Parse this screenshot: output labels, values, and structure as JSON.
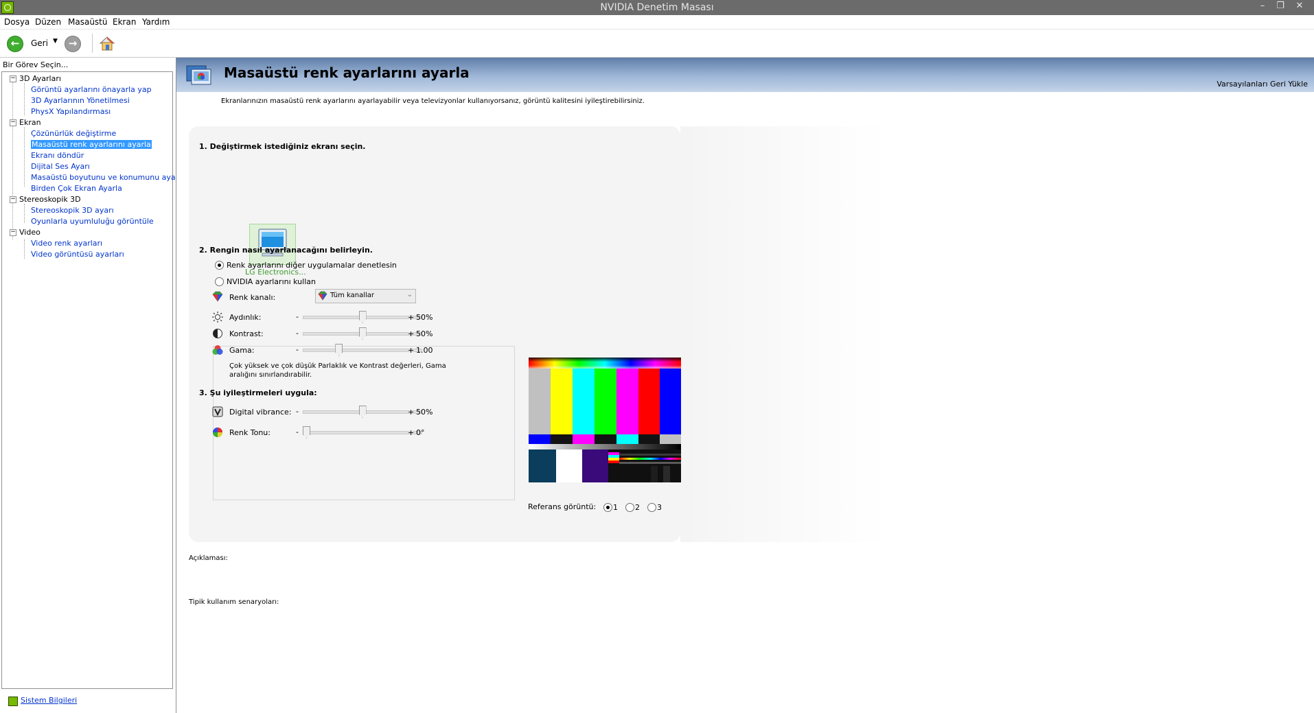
{
  "window": {
    "title": "NVIDIA Denetim Masası"
  },
  "menu": [
    "Dosya",
    "Düzen",
    "Masaüstü",
    "Ekran",
    "Yardım"
  ],
  "toolbar": {
    "back_label": "Geri"
  },
  "left": {
    "header": "Bir Görev Seçin...",
    "tree": [
      {
        "label": "3D Ayarları",
        "type": "cat"
      },
      {
        "label": "Görüntü ayarlarını önayarla yap",
        "type": "link"
      },
      {
        "label": "3D Ayarlarının Yönetilmesi",
        "type": "link"
      },
      {
        "label": "PhysX Yapılandırması",
        "type": "link"
      },
      {
        "label": "Ekran",
        "type": "cat"
      },
      {
        "label": "Çözünürlük değiştirme",
        "type": "link"
      },
      {
        "label": "Masaüstü renk ayarlarını ayarla",
        "type": "link",
        "selected": true
      },
      {
        "label": "Ekranı döndür",
        "type": "link"
      },
      {
        "label": "Dijital Ses Ayarı",
        "type": "link"
      },
      {
        "label": "Masaüstü boyutunu ve konumunu ayarla",
        "type": "link"
      },
      {
        "label": "Birden Çok Ekran Ayarla",
        "type": "link"
      },
      {
        "label": "Stereoskopik 3D",
        "type": "cat"
      },
      {
        "label": "Stereoskopik 3D ayarı",
        "type": "link"
      },
      {
        "label": "Oyunlarla uyumluluğu görüntüle",
        "type": "link"
      },
      {
        "label": "Video",
        "type": "cat"
      },
      {
        "label": "Video renk ayarları",
        "type": "link"
      },
      {
        "label": "Video görüntüsü ayarları",
        "type": "link"
      }
    ],
    "footer_link": "Sistem Bilgileri"
  },
  "main": {
    "title": "Masaüstü renk ayarlarını ayarla",
    "restore_link": "Varsayılanları Geri Yükle",
    "intro": "Ekranlarınızın masaüstü renk ayarlarını ayarlayabilir veya televizyonlar kullanıyorsanız, görüntü kalitesini iyileştirebilirsiniz.",
    "section1": "1. Değiştirmek istediğiniz ekranı seçin.",
    "monitor_label": "LG Electronics...",
    "section2": "2. Rengin nasıl ayarlanacağını belirleyin.",
    "radio_other_apps": "Renk ayarlarını diğer uygulamalar denetlesin",
    "radio_nvidia": "NVIDIA ayarlarını kullan",
    "selected_mode": "other_apps",
    "channel_label": "Renk kanalı:",
    "channel_value": "Tüm kanallar",
    "minus": "-",
    "plus": "+",
    "sliders": {
      "brightness": {
        "label": "Aydınlık:",
        "value_text": "50%",
        "fraction": 0.5
      },
      "contrast": {
        "label": "Kontrast:",
        "value_text": "50%",
        "fraction": 0.5
      },
      "gamma": {
        "label": "Gama:",
        "value_text": "1.00",
        "fraction": 0.29
      },
      "vibrance": {
        "label": "Digital vibrance:",
        "value_text": "50%",
        "fraction": 0.5
      },
      "hue": {
        "label": "Renk Tonu:",
        "value_text": "0°",
        "fraction": 0.0
      }
    },
    "note": "Çok yüksek ve çok düşük Parlaklık ve Kontrast değerleri, Gama aralığını sınırlandırabilir.",
    "section3": "3. Şu iyileştirmeleri uygula:",
    "reference_label": "Referans görüntü:",
    "reference_options": [
      "1",
      "2",
      "3"
    ],
    "reference_selected": "1",
    "description_label": "Açıklaması:",
    "scenarios_label": "Tipik kullanım senaryoları:"
  },
  "colors": {
    "nvidia_green": "#76b900",
    "link_blue": "#0033cc",
    "selection_blue": "#3399ff",
    "banner_dark": "#5f7ea8",
    "banner_light": "#c4d3e8"
  }
}
